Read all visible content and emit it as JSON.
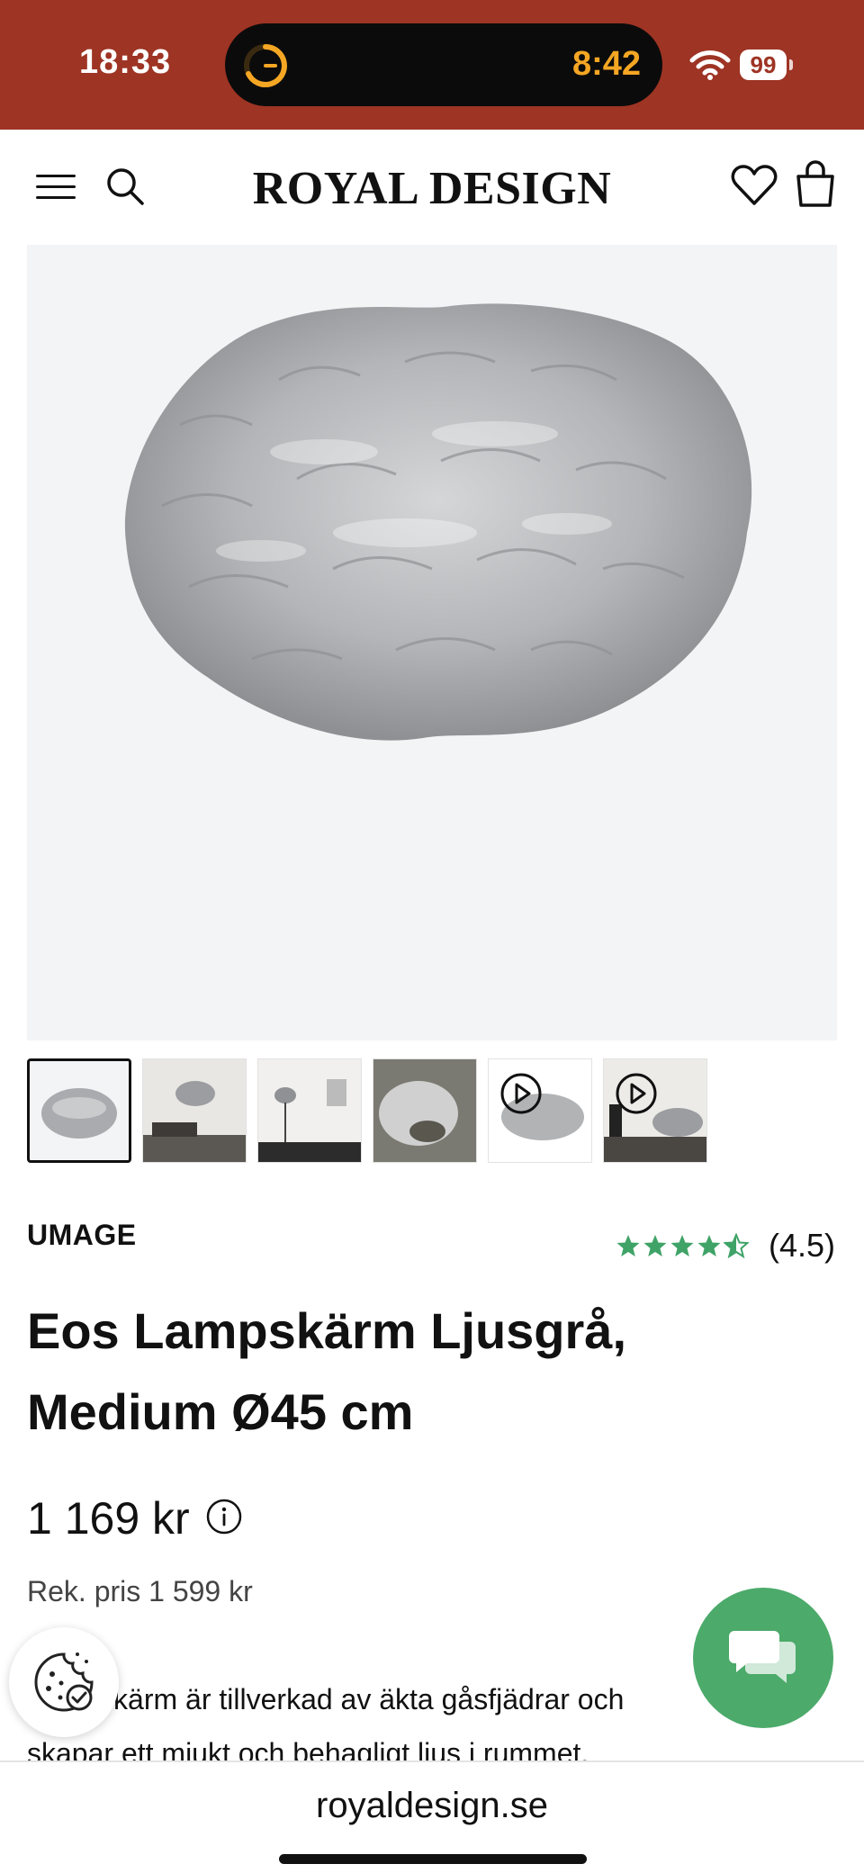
{
  "status_bar": {
    "time": "18:33",
    "island_timer": "8:42",
    "battery": "99",
    "colors": {
      "background": "#9e3424",
      "timer": "#f5a623"
    }
  },
  "header": {
    "brand": "ROYAL DESIGN",
    "icons": [
      "hamburger-icon",
      "search-icon",
      "heart-icon",
      "bag-icon"
    ]
  },
  "product": {
    "brand": "UMAGE",
    "rating": 4.5,
    "rating_text": "(4.5)",
    "title_line1": "Eos Lampskärm Ljusgrå,",
    "title_line2": "Medium Ø45 cm",
    "price": "1 169 kr",
    "recommended_price": "Rek. pris 1 599 kr",
    "description_line1": "Lampskärm är tillverkad av äkta gåsfjädrar och",
    "description_line2": "skapar ett mjukt och behagligt ljus i rummet.",
    "thumbnails": [
      {
        "kind": "image",
        "active": true
      },
      {
        "kind": "image",
        "active": false
      },
      {
        "kind": "image",
        "active": false
      },
      {
        "kind": "image",
        "active": false
      },
      {
        "kind": "video",
        "active": false
      },
      {
        "kind": "video",
        "active": false
      }
    ],
    "colors": {
      "star": "#3fa367",
      "chat": "#4caa6a"
    }
  },
  "url_bar": {
    "url": "royaldesign.se"
  }
}
